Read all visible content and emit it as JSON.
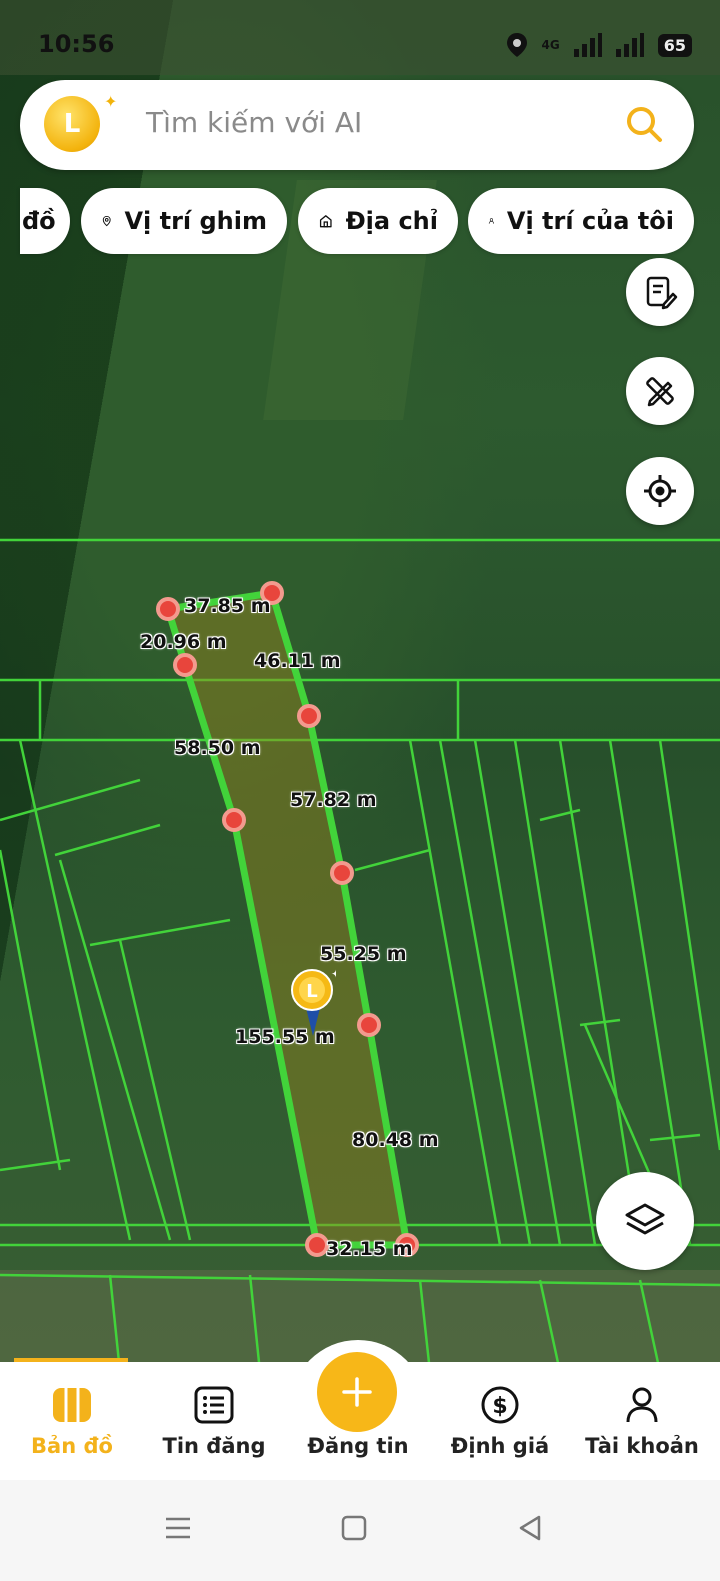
{
  "status_bar": {
    "time": "10:56",
    "network": "4G",
    "battery": "65"
  },
  "search": {
    "placeholder": "Tìm kiếm với AI",
    "logo_text": "L"
  },
  "chips": [
    {
      "label": "đồ",
      "icon": "map-icon"
    },
    {
      "label": "Vị trí ghim",
      "icon": "pin-icon"
    },
    {
      "label": "Địa chỉ",
      "icon": "home-icon"
    },
    {
      "label": "Vị trí của tôi",
      "icon": "person-icon"
    }
  ],
  "map_tools": [
    "notes-icon",
    "ruler-pencil-icon",
    "locate-icon",
    "layers-icon"
  ],
  "measurements": [
    {
      "label": "37.85 m"
    },
    {
      "label": "20.96 m"
    },
    {
      "label": "46.11 m"
    },
    {
      "label": "58.50 m"
    },
    {
      "label": "57.82 m"
    },
    {
      "label": "55.25 m"
    },
    {
      "label": "155.55 m"
    },
    {
      "label": "80.48 m"
    },
    {
      "label": "32.15 m"
    }
  ],
  "bottom_nav": {
    "items": [
      {
        "label": "Bản đồ",
        "icon": "map-icon",
        "active": true
      },
      {
        "label": "Tin đăng",
        "icon": "list-icon",
        "active": false
      },
      {
        "label": "Đăng tin",
        "icon": "plus-icon",
        "active": false
      },
      {
        "label": "Định giá",
        "icon": "dollar-icon",
        "active": false
      },
      {
        "label": "Tài khoản",
        "icon": "user-icon",
        "active": false
      }
    ]
  },
  "colors": {
    "accent": "#f3b21b",
    "parcel_line": "#42d33a",
    "vertex": "#e8453c"
  }
}
